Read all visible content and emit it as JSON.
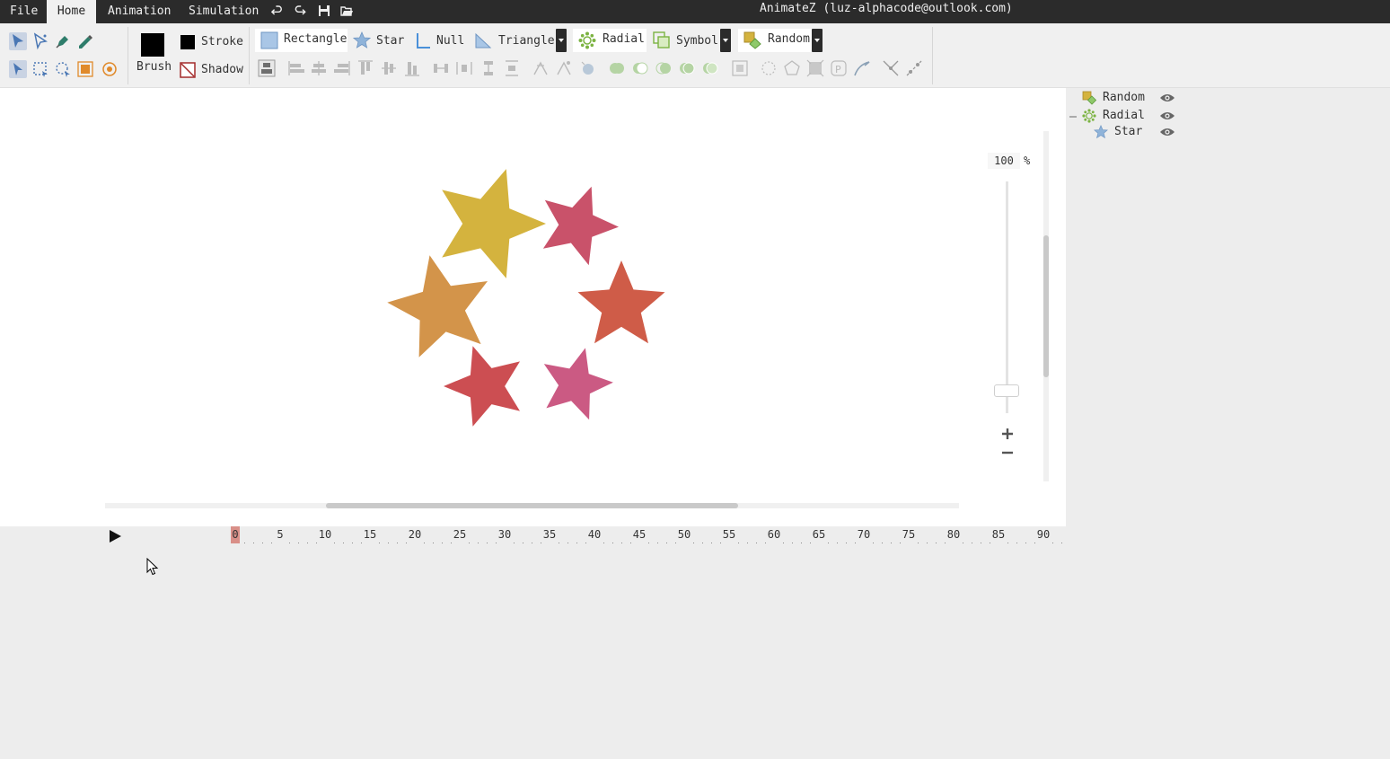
{
  "menubar": {
    "tabs": [
      {
        "label": "File",
        "active": false
      },
      {
        "label": "Home",
        "active": true
      },
      {
        "label": "Animation",
        "active": false
      },
      {
        "label": "Simulation",
        "active": false
      }
    ],
    "quick_actions": [
      "undo-icon",
      "redo-icon",
      "save-icon",
      "open-folder-icon"
    ],
    "title": "AnimateZ (luz-alphacode@outlook.com)"
  },
  "ribbon": {
    "brush_label": "Brush",
    "brush_color": "#000000",
    "stroke_label": "Stroke",
    "shadow_label": "Shadow",
    "shapes": {
      "rectangle": "Rectangle",
      "star": "Star",
      "null": "Null",
      "triangle": "Triangle"
    },
    "generators": {
      "radial": "Radial",
      "symbol": "Symbol",
      "random": "Random"
    }
  },
  "canvas": {
    "zoom_value": "100",
    "zoom_unit": "%",
    "star_colors": [
      "#d4b33e",
      "#c9526a",
      "#d3944a",
      "#cf5c48",
      "#cc4e52",
      "#cb5a83"
    ]
  },
  "layers": [
    {
      "name": "Random",
      "icon": "random-icon",
      "visible": true
    },
    {
      "name": "Radial",
      "icon": "radial-icon",
      "visible": true
    },
    {
      "name": "Star",
      "icon": "star-icon",
      "visible": true
    }
  ],
  "timeline": {
    "play_icon": "play-icon",
    "current_frame": "0",
    "tick_labels": [
      "0",
      "5",
      "10",
      "15",
      "20",
      "25",
      "30",
      "35",
      "40",
      "45",
      "50",
      "55",
      "60",
      "65",
      "70",
      "75",
      "80",
      "85",
      "90"
    ]
  },
  "colors": {
    "menubar_bg": "#2b2b2b",
    "accent_blue": "#4a77b4",
    "accent_orange": "#e08a2b",
    "accent_green": "#7cb342"
  }
}
